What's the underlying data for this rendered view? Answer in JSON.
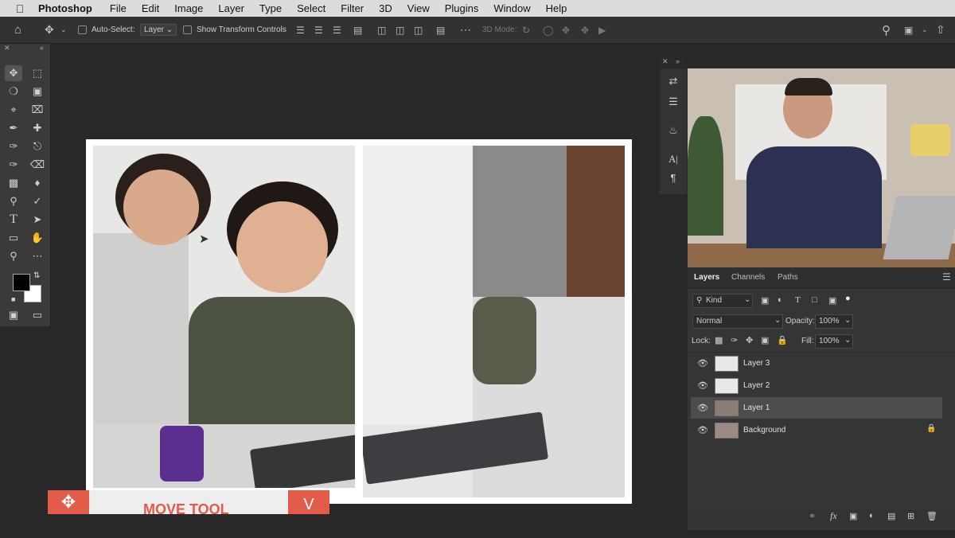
{
  "menubar": {
    "apple_icon": "apple-icon",
    "app_name": "Photoshop",
    "items": [
      "File",
      "Edit",
      "Image",
      "Layer",
      "Type",
      "Select",
      "Filter",
      "3D",
      "View",
      "Plugins",
      "Window",
      "Help"
    ]
  },
  "options_bar": {
    "auto_select_label": "Auto-Select:",
    "auto_select_value": "Layer",
    "transform_label": "Show Transform Controls",
    "mode_3d_label": "3D Mode:"
  },
  "document": {
    "caption_text": "MOVE TOOL",
    "caption_right": "V"
  },
  "layers_panel": {
    "tabs": [
      "Layers",
      "Channels",
      "Paths"
    ],
    "filter_kind": "Kind",
    "blend_mode": "Normal",
    "opacity_label": "Opacity:",
    "opacity_value": "100%",
    "lock_label": "Lock:",
    "fill_label": "Fill:",
    "fill_value": "100%",
    "layers": [
      {
        "name": "Layer 3",
        "selected": false
      },
      {
        "name": "Layer 2",
        "selected": false
      },
      {
        "name": "Layer 1",
        "selected": true
      },
      {
        "name": "Background",
        "selected": false
      }
    ]
  },
  "colors": {
    "accent_red": "#e35c4a",
    "panel_bg": "#353535",
    "workspace_bg": "#282828"
  }
}
